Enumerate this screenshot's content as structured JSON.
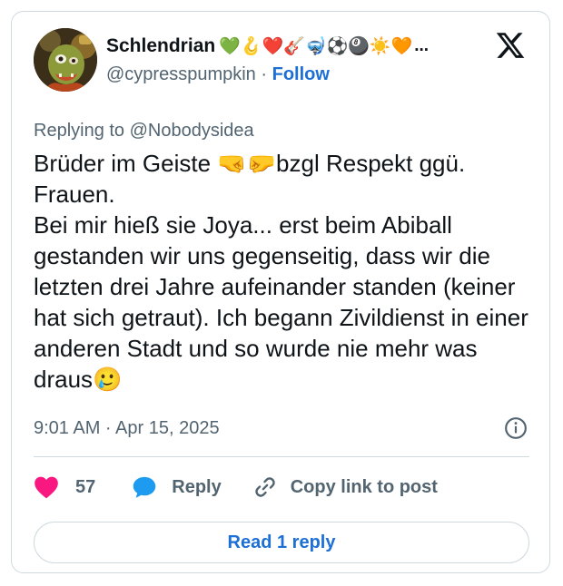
{
  "author": {
    "display_name": "Schlendrian",
    "name_emojis": [
      "💚",
      "🪝",
      "❤️",
      "🎸",
      "🤿",
      "⚽",
      "🎱",
      "☀️",
      "🧡"
    ],
    "ellipsis": "...",
    "handle": "@cypresspumpkin",
    "separator": "·",
    "follow_label": "Follow"
  },
  "platform_icon": "x-logo-icon",
  "replying_to": "Replying to @Nobodysidea",
  "tweet": {
    "line1_before": "Brüder im Geiste ",
    "line1_emojis": "🤜🤛",
    "line1_after": "bzgl Respekt ggü.",
    "line2": "Frauen.",
    "paragraph2": "Bei mir hieß sie Joya... erst beim Abiball gestanden wir uns gegenseitig, dass wir die letzten drei Jahre aufeinander standen (keiner hat sich getraut). Ich begann Zivildienst in einer anderen Stadt und so wurde nie mehr was draus",
    "end_emoji": "🥲"
  },
  "timestamp": "9:01 AM · Apr 15, 2025",
  "actions": {
    "like_count": "57",
    "reply_label": "Reply",
    "copy_label": "Copy link to post"
  },
  "read_reply_label": "Read 1 reply",
  "colors": {
    "link_blue": "#1d6fd6",
    "like_pink": "#f91880",
    "reply_blue": "#1d9bf0",
    "muted_gray": "#536471",
    "border": "#cfd9de"
  }
}
